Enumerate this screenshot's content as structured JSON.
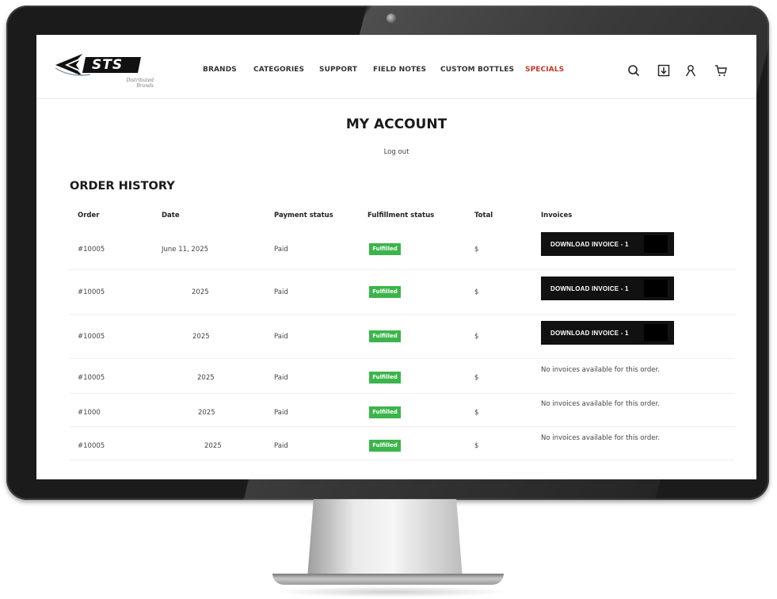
{
  "brand": {
    "name": "STS",
    "sub1": "Distributed",
    "sub2": "Brands"
  },
  "nav": [
    {
      "label": "BRANDS"
    },
    {
      "label": "CATEGORIES"
    },
    {
      "label": "SUPPORT"
    },
    {
      "label": "FIELD NOTES"
    },
    {
      "label": "CUSTOM BOTTLES"
    },
    {
      "label": "SPECIALS"
    }
  ],
  "header_icons": [
    "search-icon",
    "download-icon",
    "account-icon",
    "cart-icon"
  ],
  "colors": {
    "specials": "#c0392b",
    "fulfilled": "#3cb44b",
    "button": "#111111"
  },
  "page": {
    "title": "MY ACCOUNT",
    "logout": "Log out"
  },
  "orders": {
    "heading": "ORDER HISTORY",
    "columns": [
      "Order",
      "Date",
      "Payment status",
      "Fulfillment status",
      "Total",
      "Invoices"
    ],
    "rows": [
      {
        "order": "#10005",
        "date": "June 11, 2025",
        "payment": "Paid",
        "fulfillment": "Fulfilled",
        "total": "$",
        "invoice": "DOWNLOAD INVOICE - 1"
      },
      {
        "order": "#10005",
        "date": "2025",
        "payment": "Paid",
        "fulfillment": "Fulfilled",
        "total": "$",
        "invoice": "DOWNLOAD INVOICE - 1"
      },
      {
        "order": "#10005",
        "date": "2025",
        "payment": "Paid",
        "fulfillment": "Fulfilled",
        "total": "$",
        "invoice": "DOWNLOAD INVOICE - 1"
      },
      {
        "order": "#10005",
        "date": "2025",
        "payment": "Paid",
        "fulfillment": "Fulfilled",
        "total": "$",
        "invoice": "No invoices available for this order."
      },
      {
        "order": "#1000",
        "date": "2025",
        "payment": "Paid",
        "fulfillment": "Fulfilled",
        "total": "$",
        "invoice": "No invoices available for this order."
      },
      {
        "order": "#10005",
        "date": "2025",
        "payment": "Paid",
        "fulfillment": "Fulfilled",
        "total": "$",
        "invoice": "No invoices available for this order."
      }
    ]
  }
}
